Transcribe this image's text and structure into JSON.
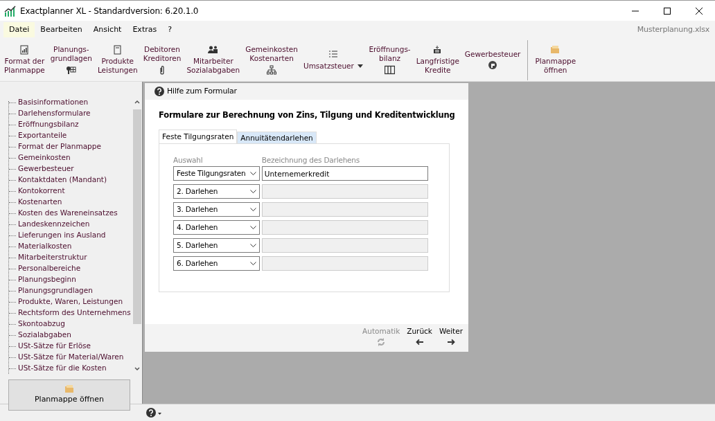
{
  "window": {
    "title": "Exactplanner XL - Standardversion: 6.20.1.0"
  },
  "menu": [
    {
      "label": "Datei",
      "selected": true
    },
    {
      "label": "Bearbeiten",
      "selected": false
    },
    {
      "label": "Ansicht",
      "selected": false
    },
    {
      "label": "Extras",
      "selected": false
    },
    {
      "label": "?",
      "selected": false
    }
  ],
  "file_name": "Musterplanung.xlsx",
  "toolbar": [
    {
      "label": "Format der\nPlanmappe",
      "kind": "icon-top"
    },
    {
      "label": "Planungs-\ngrundlagen",
      "kind": "icon-bottom"
    },
    {
      "label": "Produkte\nLeistungen",
      "kind": "icon-top"
    },
    {
      "label": "Debitoren\nKreditoren",
      "kind": "icon-bottom"
    },
    {
      "label": "Mitarbeiter\nSozialabgaben",
      "kind": "icon-top"
    },
    {
      "label": "Gemeinkosten\nKostenarten",
      "kind": "icon-bottom"
    },
    {
      "label": "Umsatzsteuer",
      "kind": "dropdown"
    },
    {
      "label": "Eröffnungs-\nbilanz",
      "kind": "icon-bottom"
    },
    {
      "label": "Langfristige\nKredite",
      "kind": "icon-top"
    },
    {
      "label": "Gewerbesteuer",
      "kind": "icon-bottom"
    },
    {
      "label": "Planmappe\nöffnen",
      "kind": "separated"
    }
  ],
  "sidebar": {
    "items": [
      "Basisinformationen",
      "Darlehensformulare",
      "Eröffnungsbilanz",
      "Exportanteile",
      "Format der Planmappe",
      "Gemeinkosten",
      "Gewerbesteuer",
      "Kontaktdaten (Mandant)",
      "Kontokorrent",
      "Kostenarten",
      "Kosten des Wareneinsatzes",
      "Landeskennzeichen",
      "Lieferungen ins Ausland",
      "Materialkosten",
      "Mitarbeiterstruktur",
      "Personalbereiche",
      "Planungsbeginn",
      "Planungsgrundlagen",
      "Produkte, Waren, Leistungen",
      "Rechtsform des Unternehmens",
      "Skontoabzug",
      "Sozialabgaben",
      "USt-Sätze für Erlöse",
      "USt-Sätze für Material/Waren",
      "USt-Sätze für die Kosten"
    ],
    "open_button": "Planmappe öffnen"
  },
  "form": {
    "help": "Hilfe zum Formular",
    "title": "Formulare zur Berechnung von Zins, Tilgung und Kreditentwicklung",
    "tabs": [
      {
        "label": "Feste Tilgungsraten",
        "selected": true
      },
      {
        "label": "Annuitätendarlehen",
        "selected": false
      }
    ],
    "columns": [
      "Auswahl",
      "Bezeichnung des Darlehens"
    ],
    "rows": [
      {
        "choice": "Feste Tilgungsraten",
        "name": "Unternemerkredit",
        "disabled": false
      },
      {
        "choice": "2. Darlehen",
        "name": "",
        "disabled": true
      },
      {
        "choice": "3. Darlehen",
        "name": "",
        "disabled": true
      },
      {
        "choice": "4. Darlehen",
        "name": "",
        "disabled": true
      },
      {
        "choice": "5. Darlehen",
        "name": "",
        "disabled": true
      },
      {
        "choice": "6. Darlehen",
        "name": "",
        "disabled": true
      }
    ],
    "footer": [
      {
        "label": "Automatik",
        "disabled": true
      },
      {
        "label": "Zurück",
        "disabled": false
      },
      {
        "label": "Weiter",
        "disabled": false
      }
    ]
  }
}
